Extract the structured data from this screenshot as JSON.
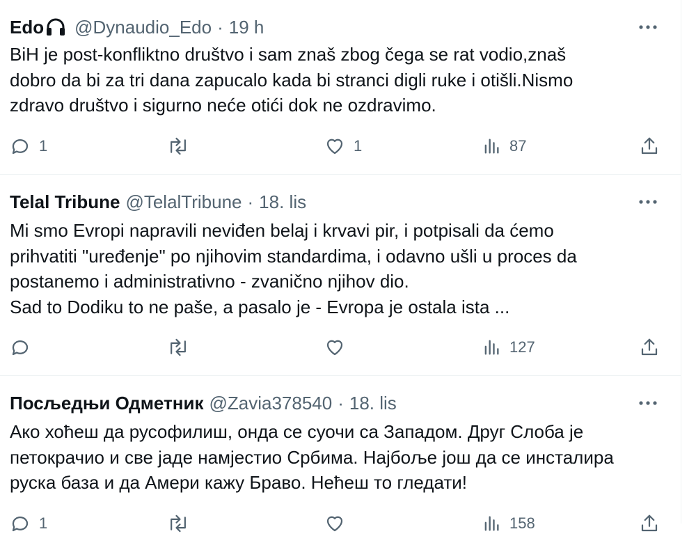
{
  "tweets": [
    {
      "author": "Edo",
      "author_icon": "headphones-icon",
      "handle": "@Dynaudio_Edo",
      "separator": "·",
      "time": "19 h",
      "text": "BiH je post-konfliktno društvo i sam znaš zbog čega se rat vodio,znaš\ndobro da bi za tri dana zapucalo kada bi stranci digli ruke i otišli.Nismo\nzdravo društvo i sigurno neće otići dok ne ozdravimo.",
      "replies": "1",
      "retweets": "",
      "likes": "1",
      "views": "87"
    },
    {
      "author": "Telal Tribune",
      "handle": "@TelalTribune",
      "separator": "·",
      "time": "18. lis",
      "text": "Mi smo Evropi napravili neviđen belaj i krvavi pir, i potpisali da ćemo\nprihvatiti \"uređenje\" po njihovim standardima, i odavno ušli u proces da\npostanemo i administrativno - zvanično njihov dio.\nSad to Dodiku to ne paše, a pasalo je - Evropa je ostala ista ...",
      "replies": "",
      "retweets": "",
      "likes": "",
      "views": "127"
    },
    {
      "author": "Посљедњи Одметник",
      "handle": "@Zavia378540",
      "separator": "·",
      "time": "18. lis",
      "text": "Ако хоћеш да русофилиш, онда се суочи са Западом. Друг Слоба је\nпетокрачио и све јаде намјестио Србима. Најбоље још да се инсталира\nруска база и да Амери кажу Браво. Нећеш то гледати!",
      "replies": "1",
      "retweets": "",
      "likes": "",
      "views": "158"
    }
  ],
  "icons": {
    "more": "more-dots-icon",
    "reply": "reply-icon",
    "retweet": "retweet-icon",
    "like": "heart-icon",
    "views": "views-icon",
    "share": "share-icon"
  },
  "colors": {
    "text": "#0f1419",
    "secondary": "#536471",
    "divider": "#eff3f4"
  }
}
